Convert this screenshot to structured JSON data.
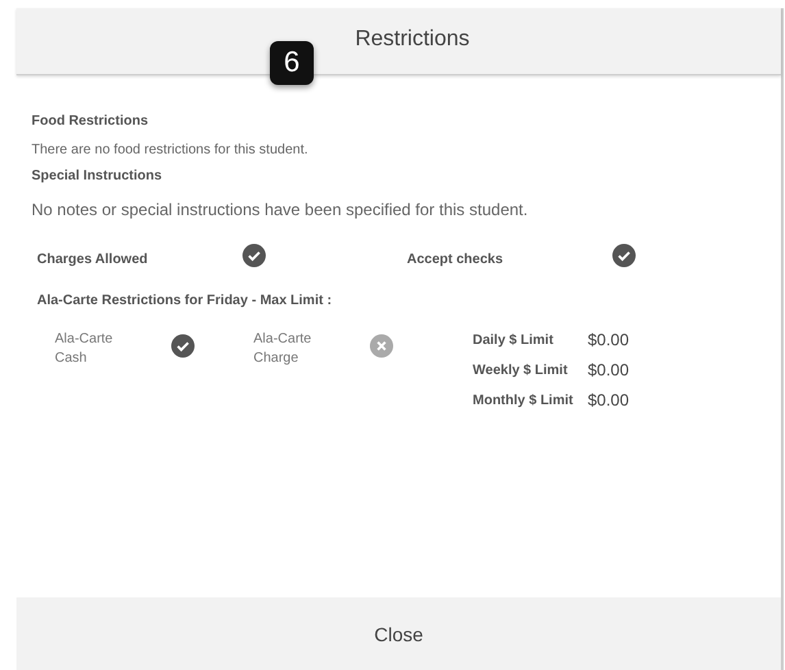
{
  "dialog": {
    "title": "Restrictions",
    "step_badge": "6"
  },
  "sections": [
    {
      "heading": "Food Restrictions",
      "text": "There are no food restrictions for this student.",
      "kind": "note"
    },
    {
      "heading": "Special Instructions",
      "text": "No notes or special instructions have been specified for this student.",
      "kind": "message"
    }
  ],
  "permissions": [
    {
      "label": "Charges Allowed",
      "checked": true
    },
    {
      "label": "Accept checks",
      "checked": true
    }
  ],
  "ala_carte": {
    "heading": "Ala-Carte Restrictions for Friday - Max Limit :",
    "options": [
      {
        "label": "Ala-Carte Cash",
        "checked": true
      },
      {
        "label": "Ala-Carte Charge",
        "checked": false
      }
    ],
    "limits": [
      {
        "label": "Daily $ Limit",
        "value": "$0.00"
      },
      {
        "label": "Weekly $ Limit",
        "value": "$0.00"
      },
      {
        "label": "Monthly $ Limit",
        "value": "$0.00"
      }
    ]
  },
  "footer": {
    "button": "Close"
  }
}
